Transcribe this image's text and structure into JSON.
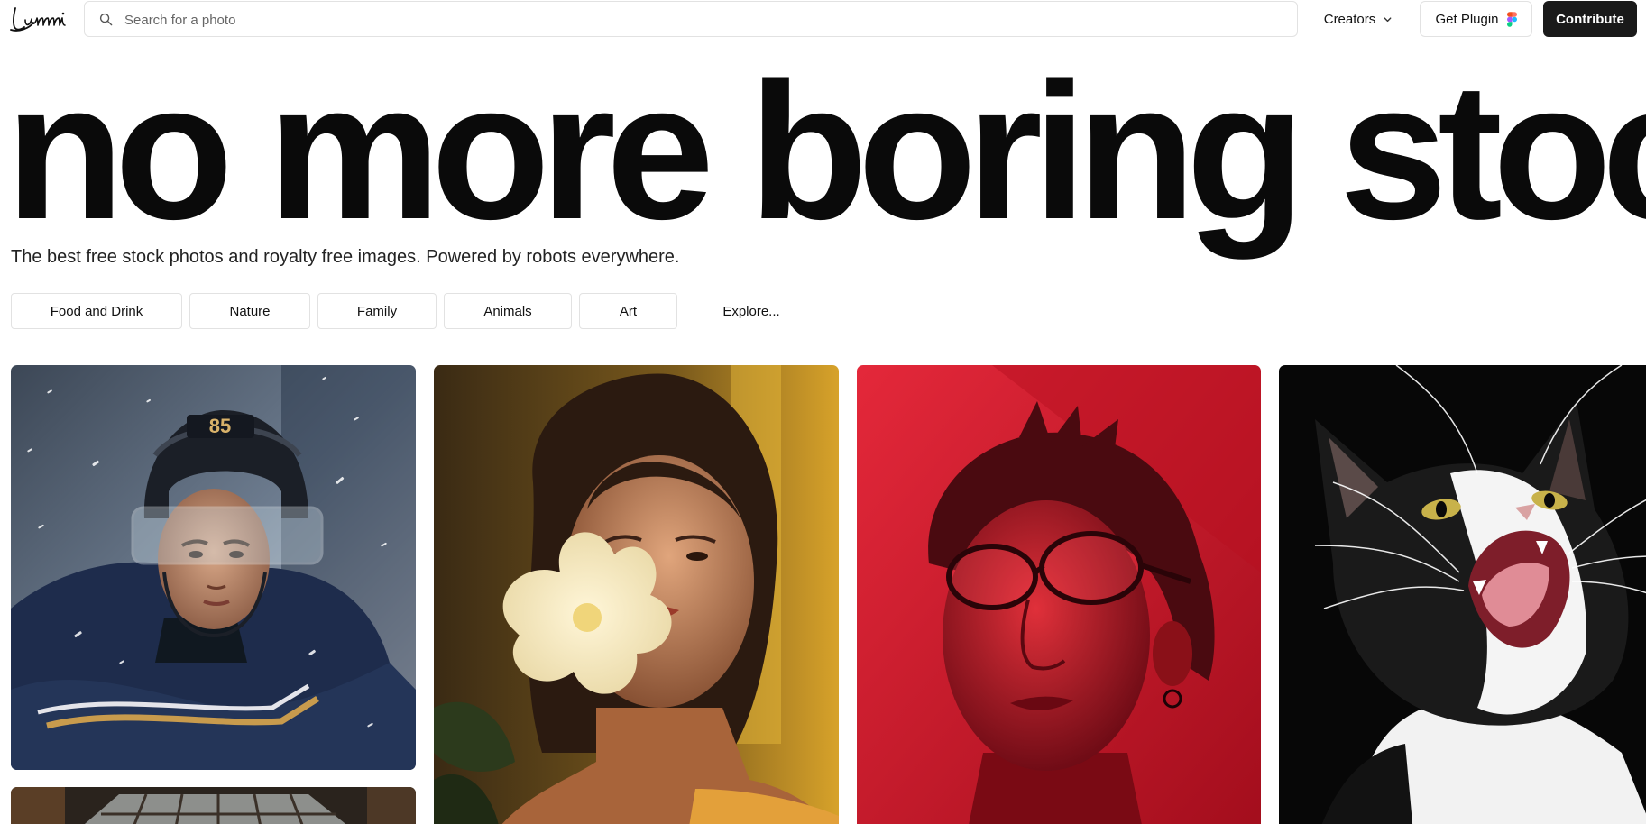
{
  "header": {
    "logo_text": "Lummi",
    "search": {
      "placeholder": "Search for a photo",
      "icon": "search-icon"
    },
    "creators_label": "Creators",
    "plugin_label": "Get Plugin",
    "contribute_label": "Contribute"
  },
  "hero": {
    "title": "no more boring stock",
    "subtitle": "The best free stock photos and royalty free images. Powered by robots everywhere."
  },
  "categories": [
    "Food and Drink",
    "Nature",
    "Family",
    "Animals",
    "Art",
    "Explore..."
  ],
  "photos": [
    {
      "subject": "hockey-player",
      "jersey_number": "85"
    },
    {
      "subject": "woman-with-flower"
    },
    {
      "subject": "man-in-red-light"
    },
    {
      "subject": "black-and-white-cat"
    },
    {
      "subject": "interior-skylight"
    }
  ],
  "colors": {
    "contribute_bg": "#1a1a1a",
    "border": "#e2e2e2",
    "red_photo": "#d41426"
  }
}
